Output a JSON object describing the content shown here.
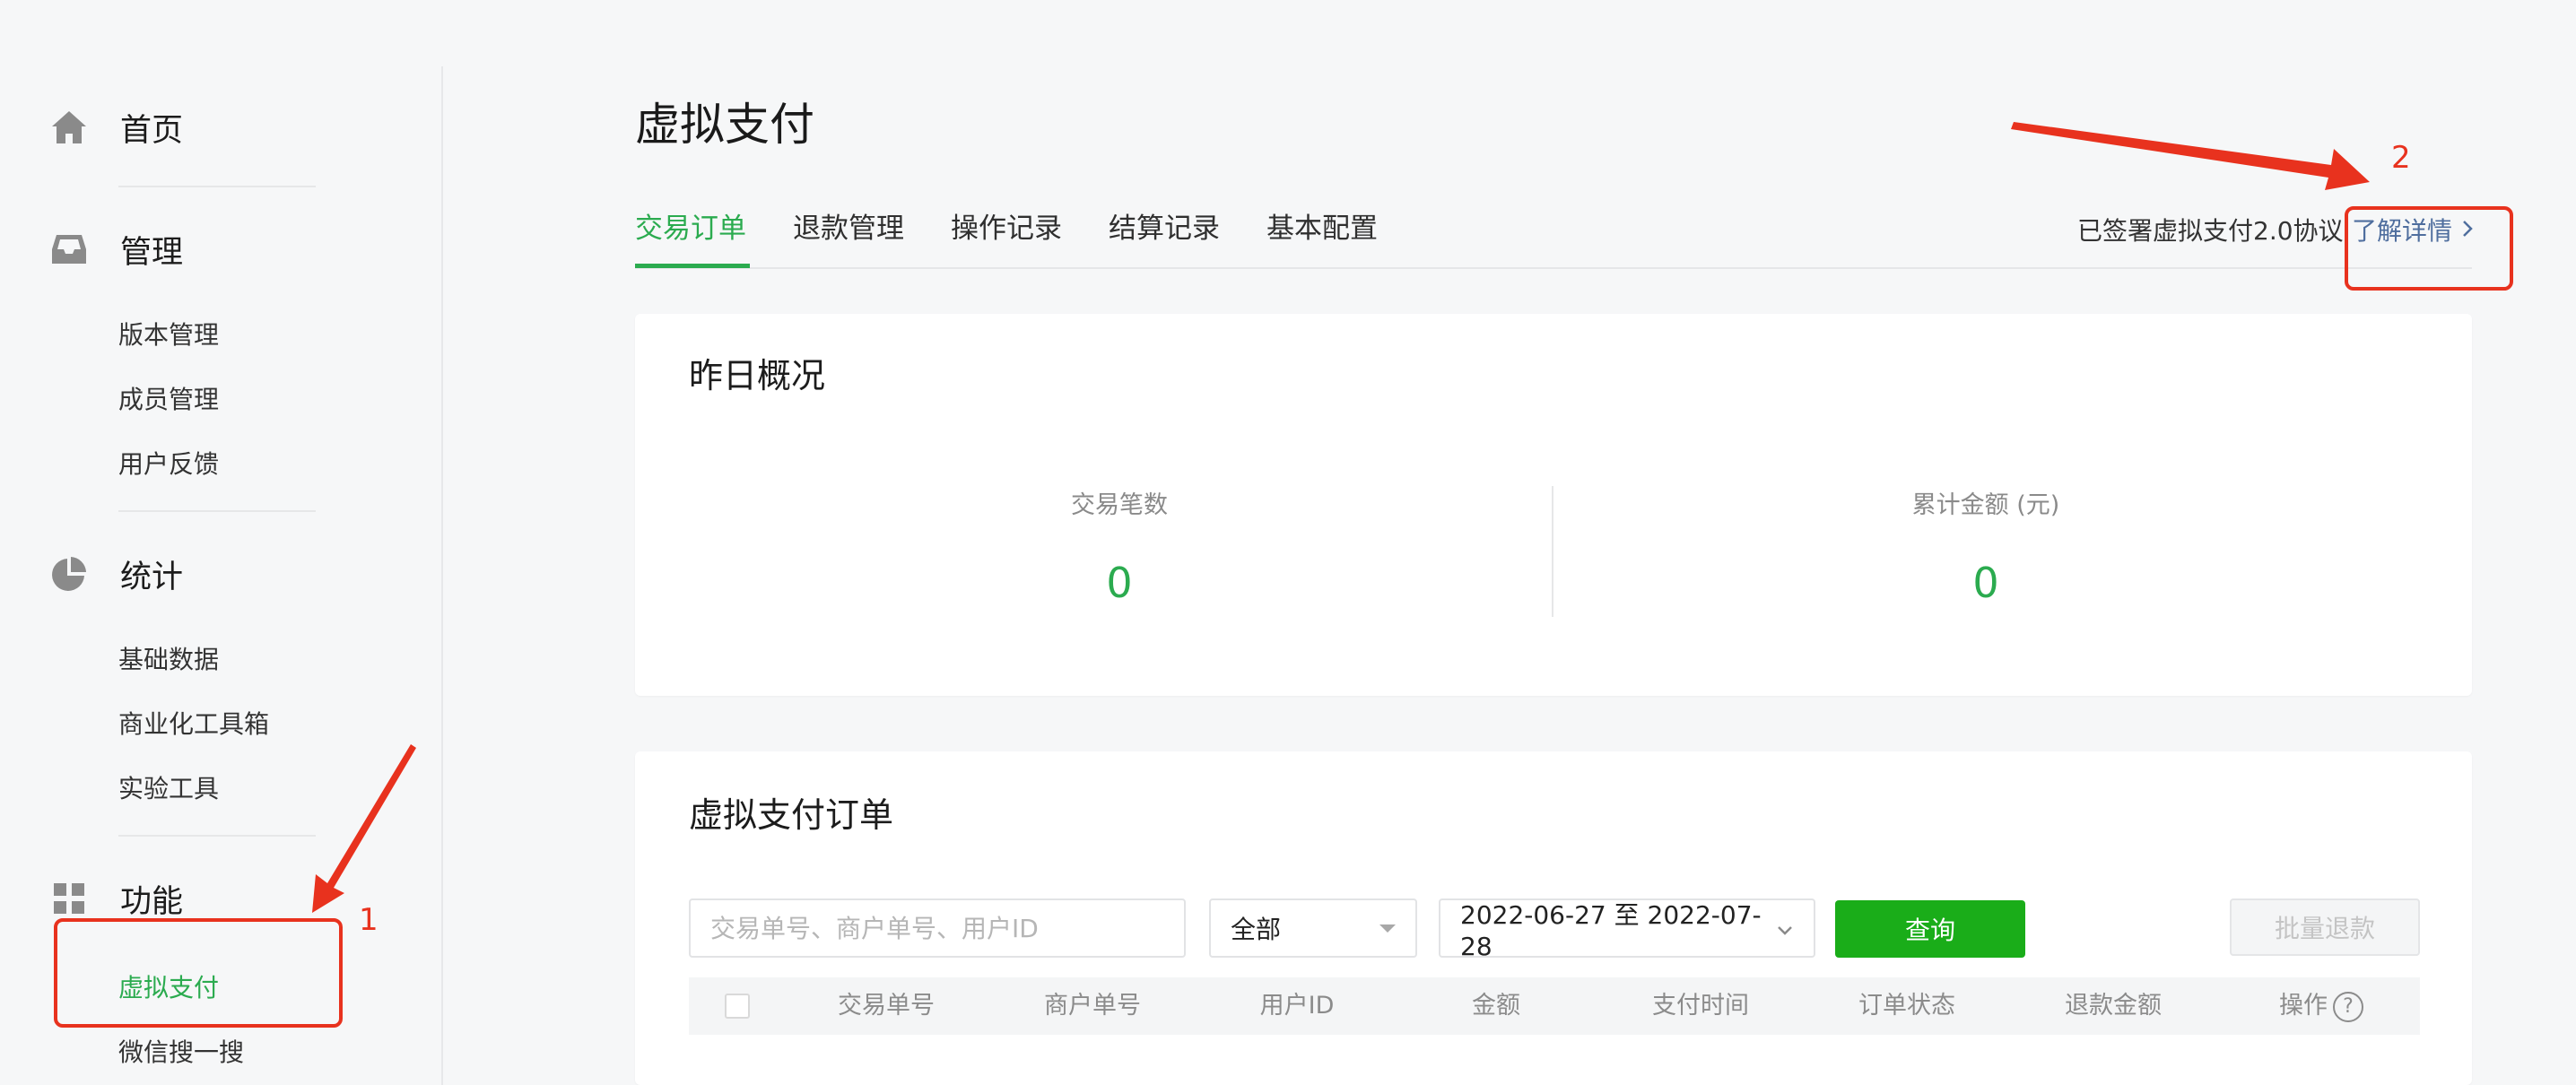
{
  "sidebar": {
    "home": {
      "label": "首页",
      "icon": "home-icon"
    },
    "manage": {
      "label": "管理",
      "icon": "inbox-icon",
      "items": [
        "版本管理",
        "成员管理",
        "用户反馈"
      ]
    },
    "stats": {
      "label": "统计",
      "icon": "pie-chart-icon",
      "items": [
        "基础数据",
        "商业化工具箱",
        "实验工具"
      ]
    },
    "features": {
      "label": "功能",
      "icon": "grid-icon",
      "items": [
        "虚拟支付",
        "微信搜一搜"
      ],
      "active_item": "虚拟支付"
    }
  },
  "page": {
    "title": "虚拟支付",
    "tabs": [
      "交易订单",
      "退款管理",
      "操作记录",
      "结算记录",
      "基本配置"
    ],
    "active_tab": "交易订单",
    "agreement_text": "已签署虚拟支付2.0协议",
    "agreement_link": "了解详情",
    "agreement_chevron": "chevron-right-icon"
  },
  "overview": {
    "title": "昨日概况",
    "stats": [
      {
        "label": "交易笔数",
        "value": "0"
      },
      {
        "label": "累计金额 (元)",
        "value": "0"
      }
    ]
  },
  "orders": {
    "title": "虚拟支付订单",
    "search_placeholder": "交易单号、商户单号、用户ID",
    "status_select": "全部",
    "date_range": "2022-06-27 至 2022-07-28",
    "query_button": "查询",
    "batch_refund_button": "批量退款",
    "columns": [
      "交易单号",
      "商户单号",
      "用户ID",
      "金额",
      "支付时间",
      "订单状态",
      "退款金额",
      "操作"
    ],
    "help_icon": "question-circle-icon"
  },
  "annotations": {
    "marker1": "1",
    "marker2": "2"
  },
  "colors": {
    "accent_green": "#2bab4f",
    "button_green": "#1aad19",
    "annotation_red": "#e8321e",
    "link_blue": "#4f6e9e"
  }
}
